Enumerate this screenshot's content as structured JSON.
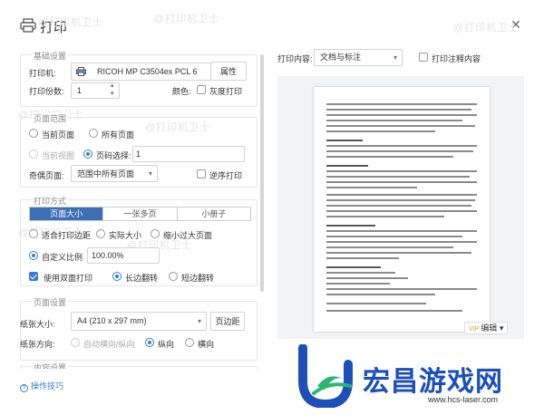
{
  "window": {
    "title": "打印",
    "watermark": "@打印机卫士"
  },
  "basic": {
    "section_title": "基础设置",
    "printer_label": "打印机:",
    "printer_value": "RICOH MP C3504ex PCL 6",
    "properties_button": "属性",
    "copies_label": "打印份数:",
    "copies_value": "1",
    "color_label": "颜色:",
    "grayscale_label": "灰度打印"
  },
  "range": {
    "section_title": "页面范围",
    "current_page": "当前页面",
    "all_pages": "所有页面",
    "current_view": "当前视图",
    "page_select_label": "页码选择:",
    "page_select_value": "1",
    "odd_even_label": "奇偶页面:",
    "odd_even_value": "范围中所有页面",
    "reverse_label": "逆序打印"
  },
  "method": {
    "section_title": "打印方式",
    "tabs": [
      "页面大小",
      "一张多页",
      "小册子"
    ],
    "fit_margin": "适合打印边距",
    "actual_size": "实际大小",
    "shrink_oversize": "缩小过大页面",
    "custom_scale": "自定义比例",
    "scale_value": "100.00%",
    "duplex_label": "使用双面打印",
    "long_edge": "长边翻转",
    "short_edge": "短边翻转"
  },
  "page_setup": {
    "section_title": "页面设置",
    "paper_size_label": "纸张大小:",
    "paper_size_value": "A4 (210 x 297 mm)",
    "margin_button": "页边距",
    "orientation_label": "纸张方向:",
    "auto_orientation": "自动横向/纵向",
    "portrait": "纵向",
    "landscape": "横向"
  },
  "content_setup": {
    "section_title": "内容设置"
  },
  "help": {
    "label": "操作技巧"
  },
  "preview": {
    "content_label": "打印内容:",
    "content_value": "文档与标注",
    "print_annotations_label": "打印注释内容",
    "vip_badge": "VIP",
    "edit_label": "编辑"
  },
  "brand": {
    "name": "宏昌游戏网",
    "url": "www.hcs-laser.com"
  },
  "colors": {
    "accent": "#3a7bd5",
    "tab_active": "#3d6fb6",
    "brand_blue": "#1d4fb8"
  }
}
